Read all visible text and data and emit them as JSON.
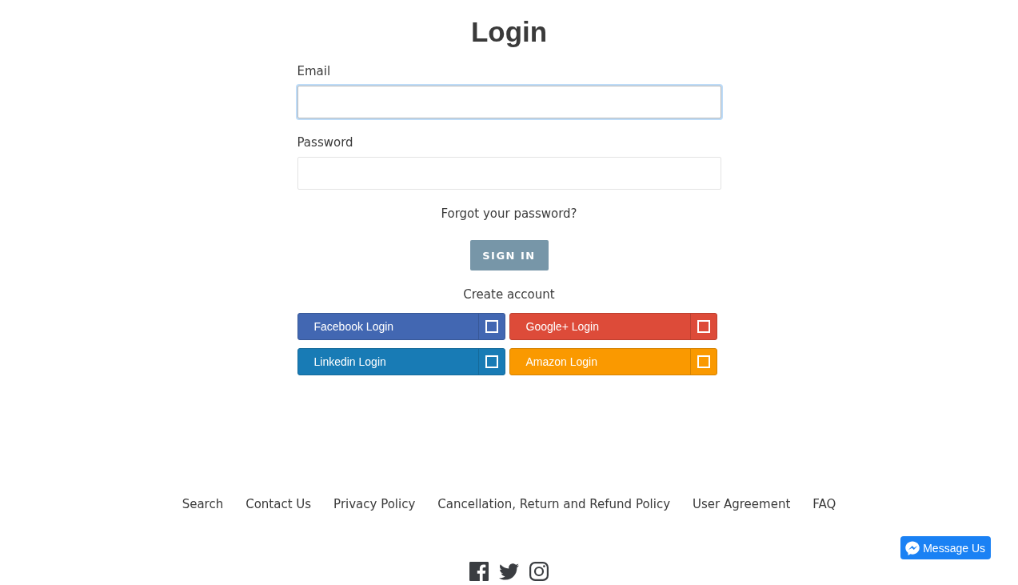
{
  "title": "Login",
  "fields": [
    {
      "label": "Email",
      "focused": true
    },
    {
      "label": "Password",
      "focused": false
    }
  ],
  "forgot_link": "Forgot your password?",
  "sign_in_button": "SIGN IN",
  "create_account_link": "Create account",
  "social_logins": [
    {
      "label": "Facebook Login",
      "color": "#4267b2"
    },
    {
      "label": "Google+ Login",
      "color": "#dd4b39"
    },
    {
      "label": "Linkedin Login",
      "color": "#187bb5"
    },
    {
      "label": "Amazon Login",
      "color": "#fa9900"
    }
  ],
  "footer_links": [
    "Search",
    "Contact Us",
    "Privacy Policy",
    "Cancellation, Return and Refund Policy",
    "User Agreement",
    "FAQ"
  ],
  "messenger_button": "Message Us"
}
